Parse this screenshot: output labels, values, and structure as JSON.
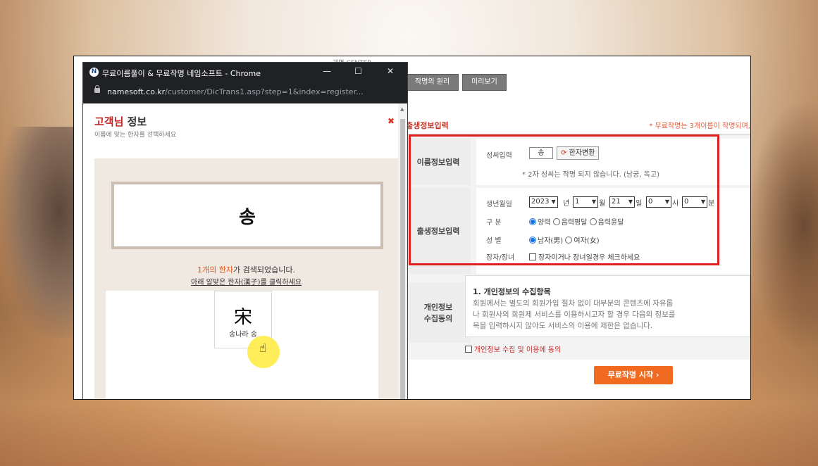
{
  "popup": {
    "title": "무료이름풀이 & 무료작명 네임소프트 - Chrome",
    "favicon_glyph": "N",
    "minimize": "—",
    "maximize": "☐",
    "close": "✕",
    "url_host": "namesoft.co.kr",
    "url_path": "/customer/DicTrans1.asp?step=1&index=register...",
    "customer_title_red": "고객님",
    "customer_title_dark": " 정보",
    "customer_sub": "이름에 맞는 한자를 선택하세요",
    "close_x": "✖",
    "name_display": "송",
    "found_count": "1개의 한자",
    "found_rest": "가 검색되었습니다.",
    "click_msg": "아래 알맞은 한자(漢子)를 클릭하세요",
    "hanja_char": "宋",
    "hanja_reading": "송나라 송"
  },
  "page": {
    "header_partial": "개명 CENTER",
    "btn_principle": "작명의 원리",
    "btn_preview": "미리보기",
    "section_title": "출생정보입력",
    "section_note": "* 무료작명는 3개이름이 작명되며,",
    "name_info_label": "이름정보입력",
    "surname_label": "성씨입력",
    "surname_value": "송",
    "hanja_convert_btn": "한자변환",
    "surname_note": "* 2자 성씨는 작명 되지 않습니다. (남궁, 독고)",
    "birth_info_label": "출생정보입력",
    "birth_label": "생년월일",
    "year": "2023",
    "year_unit": "년",
    "month": "1",
    "month_unit": "월",
    "day": "21",
    "day_unit": "일",
    "hour": "0",
    "hour_unit": "시",
    "minute": "0",
    "minute_unit": "분",
    "calendar_label": "구 분",
    "cal_solar": "양력",
    "cal_lunar_normal": "음력평달",
    "cal_lunar_leap": "음력윤달",
    "gender_label": "성 별",
    "gender_male": "남자(男)",
    "gender_female": "여자(女)",
    "eldest_label": "장자/장녀",
    "eldest_check": "장자이거나 장녀일경우 체크하세요",
    "privacy_label_1": "개인정보",
    "privacy_label_2": "수집동의",
    "privacy_heading": "1. 개인정보의 수집항목",
    "privacy_text_1": "회원께서는 별도의 회원가입 절차 없이 대부분의 콘텐츠에 자유롭",
    "privacy_text_2": "나 회원사의 회원제 서비스를 이용하시고자 할 경우 다음의 정보를",
    "privacy_text_3": "목을 입력하시지 않아도 서비스의 이용에 제한은 없습니다.",
    "privacy_agree": "개인정보 수집 및 이용에 동의",
    "start_btn": "무료작명 시작  ›"
  },
  "colors": {
    "accent_red": "#e02020",
    "start_orange": "#f06a1f",
    "title_red": "#c62828"
  }
}
